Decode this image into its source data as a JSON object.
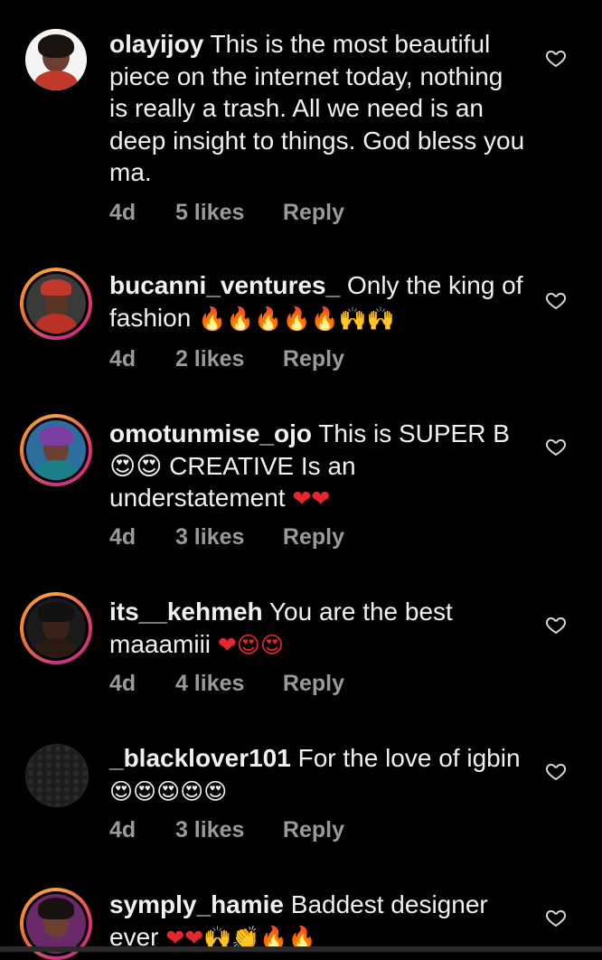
{
  "comments": [
    {
      "username": "olayijoy",
      "text": "This is the most beautiful piece on the internet today, nothing is really a trash. All we need is an deep insight to things. God bless you ma.",
      "emoji": "",
      "time": "4d",
      "likes": "5 likes",
      "reply": "Reply"
    },
    {
      "username": "bucanni_ventures_",
      "text": "Only the king of fashion",
      "emoji": "🔥🔥🔥🔥🔥🙌🙌",
      "time": "4d",
      "likes": "2 likes",
      "reply": "Reply"
    },
    {
      "username": "omotunmise_ojo",
      "text": "This is SUPER B😍😍 CREATIVE Is an understatement",
      "emoji": "❤❤",
      "time": "4d",
      "likes": "3 likes",
      "reply": "Reply"
    },
    {
      "username": "its__kehmeh",
      "text": "You are the best maaamiii",
      "emoji": "❤😍😍",
      "time": "4d",
      "likes": "4 likes",
      "reply": "Reply"
    },
    {
      "username": "_blacklover101",
      "text": "For the love of igbin",
      "emoji": "😍😍😍😍😍",
      "time": "4d",
      "likes": "3 likes",
      "reply": "Reply"
    },
    {
      "username": "symply_hamie",
      "text": "Baddest designer ever",
      "emoji": "❤❤🙌👏🔥🔥",
      "time": "",
      "likes": "",
      "reply": ""
    }
  ],
  "icons": {
    "heart": "heart-outline-icon"
  },
  "colors": {
    "background": "#000000",
    "text": "#f0f0f0",
    "meta": "#9a9a9a",
    "story_ring_start": "#f9a03f",
    "story_ring_end": "#c13584"
  }
}
